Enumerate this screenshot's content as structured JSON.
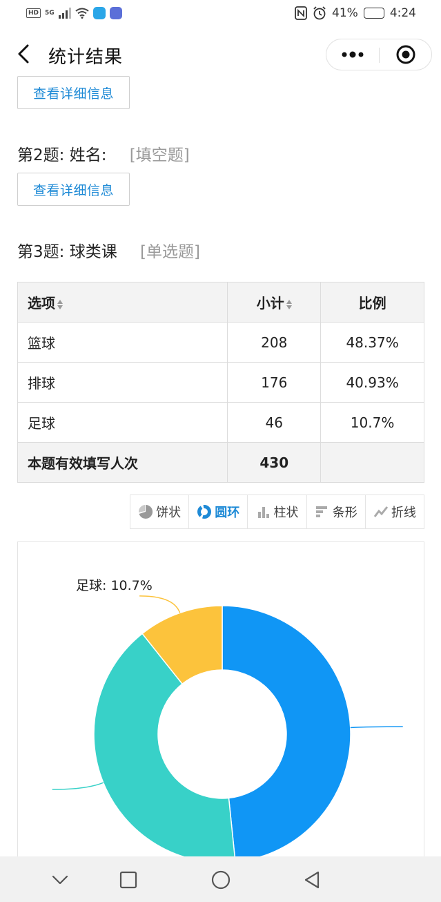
{
  "status_bar": {
    "hd": "HD",
    "signal": "5G",
    "battery": "41%",
    "time": "4:24"
  },
  "navbar": {
    "title": "统计结果",
    "icons": [
      "back-icon",
      "more-icon",
      "target-icon"
    ]
  },
  "question1": {
    "detail_button": "查看详细信息"
  },
  "question2": {
    "number": "第2题:",
    "text": "姓名:",
    "type": "[填空题]",
    "detail_button": "查看详细信息"
  },
  "question3": {
    "number": "第3题:",
    "text": "球类课",
    "type": "[单选题]"
  },
  "table": {
    "headers": [
      "选项",
      "小计",
      "比例"
    ],
    "rows": [
      {
        "option": "篮球",
        "count": "208",
        "ratio": "48.37%"
      },
      {
        "option": "排球",
        "count": "176",
        "ratio": "40.93%"
      },
      {
        "option": "足球",
        "count": "46",
        "ratio": "10.7%"
      }
    ],
    "total_label": "本题有效填写人次",
    "total_count": "430"
  },
  "chart_tabs": [
    {
      "label": "饼状",
      "icon": "pie-icon",
      "active": false
    },
    {
      "label": "圆环",
      "icon": "ring-icon",
      "active": true
    },
    {
      "label": "柱状",
      "icon": "column-icon",
      "active": false
    },
    {
      "label": "条形",
      "icon": "bar-icon",
      "active": false
    },
    {
      "label": "折线",
      "icon": "line-icon",
      "active": false
    }
  ],
  "chart_data": {
    "type": "pie",
    "variant": "donut",
    "categories": [
      "篮球",
      "排球",
      "足球"
    ],
    "values": [
      208,
      176,
      46
    ],
    "percentages": [
      48.37,
      40.93,
      10.7
    ],
    "colors": [
      "#1096f5",
      "#38d1c8",
      "#fcc33c"
    ],
    "visible_labels": [
      "足球: 10.7%"
    ]
  },
  "bottom_nav": {
    "icons": [
      "chevron-down-icon",
      "square-icon",
      "circle-icon",
      "triangle-back-icon"
    ]
  }
}
